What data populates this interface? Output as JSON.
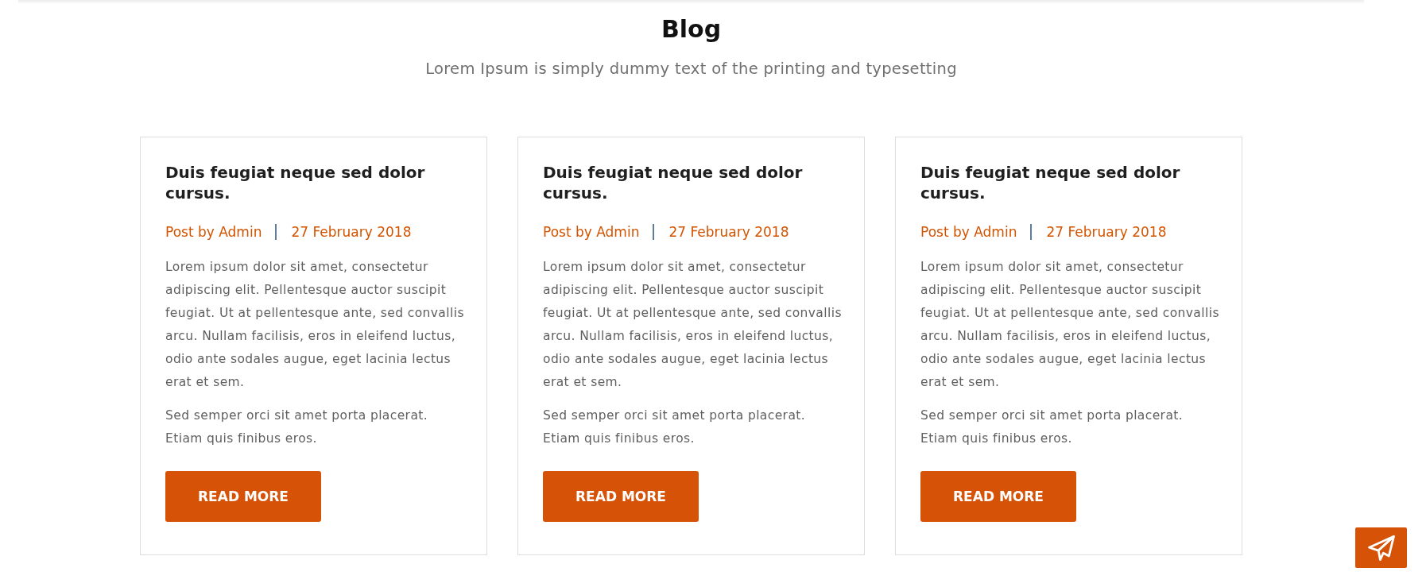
{
  "header": {
    "title": "Blog",
    "subtitle": "Lorem Ipsum is simply dummy text of the printing and typesetting"
  },
  "posts": [
    {
      "title": "Duis feugiat neque sed dolor cursus.",
      "author": "Post by Admin",
      "date": "27 February 2018",
      "paragraphs": [
        "Lorem ipsum dolor sit amet, consectetur adipiscing elit. Pellentesque auctor suscipit feugiat. Ut at pellentesque ante, sed convallis arcu. Nullam facilisis, eros in eleifend luctus, odio ante sodales augue, eget lacinia lectus erat et sem.",
        "Sed semper orci sit amet porta placerat. Etiam quis finibus eros."
      ],
      "button": "READ MORE"
    },
    {
      "title": "Duis feugiat neque sed dolor cursus.",
      "author": "Post by Admin",
      "date": "27 February 2018",
      "paragraphs": [
        "Lorem ipsum dolor sit amet, consectetur adipiscing elit. Pellentesque auctor suscipit feugiat. Ut at pellentesque ante, sed convallis arcu. Nullam facilisis, eros in eleifend luctus, odio ante sodales augue, eget lacinia lectus erat et sem.",
        "Sed semper orci sit amet porta placerat. Etiam quis finibus eros."
      ],
      "button": "READ MORE"
    },
    {
      "title": "Duis feugiat neque sed dolor cursus.",
      "author": "Post by Admin",
      "date": "27 February 2018",
      "paragraphs": [
        "Lorem ipsum dolor sit amet, consectetur adipiscing elit. Pellentesque auctor suscipit feugiat. Ut at pellentesque ante, sed convallis arcu. Nullam facilisis, eros in eleifend luctus, odio ante sodales augue, eget lacinia lectus erat et sem.",
        "Sed semper orci sit amet porta placerat. Etiam quis finibus eros."
      ],
      "button": "READ MORE"
    }
  ]
}
